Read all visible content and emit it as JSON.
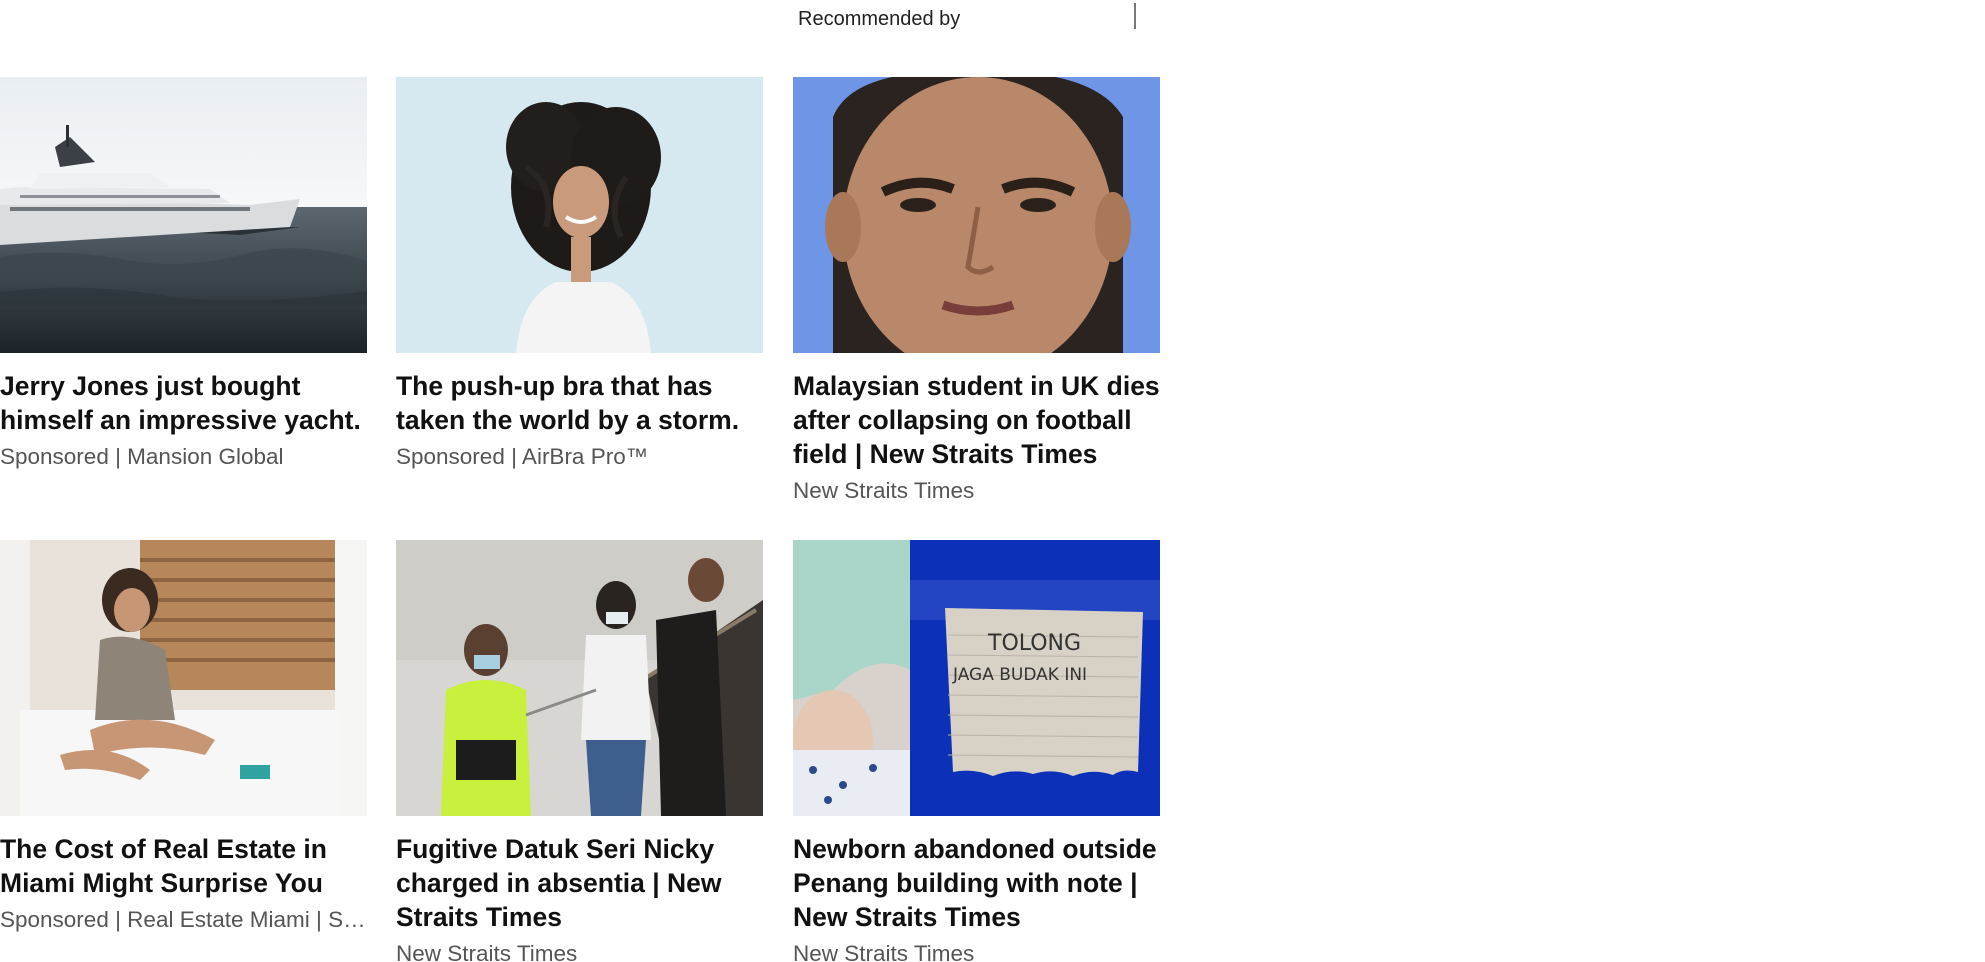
{
  "header": {
    "recommended_label": "Recommended by"
  },
  "cards": [
    {
      "headline": "Jerry Jones just bought himself an impressive yacht.",
      "source": "Sponsored | Mansion Global",
      "image": "yacht-photo"
    },
    {
      "headline": "The push-up bra that has taken the world by a storm.",
      "source": "Sponsored | AirBra Pro™",
      "image": "woman-curly-hair-photo"
    },
    {
      "headline": "Malaysian student in UK dies after collapsing on football field | New Straits Times",
      "source": "New Straits Times",
      "image": "man-portrait-photo"
    },
    {
      "headline": "The Cost of Real Estate in Miami Might Surprise You",
      "source": "Sponsored | Real Estate Miami | Search Ads",
      "image": "woman-on-bed-photo"
    },
    {
      "headline": "Fugitive Datuk Seri Nicky charged in absentia | New Straits Times",
      "source": "New Straits Times",
      "image": "police-escort-photo"
    },
    {
      "headline": "Newborn abandoned outside Penang building with note | New Straits Times",
      "source": "New Straits Times",
      "image": "baby-and-note-photo",
      "note_line1": "TOLONG",
      "note_line2": "JAGA BUDAK INI"
    }
  ]
}
